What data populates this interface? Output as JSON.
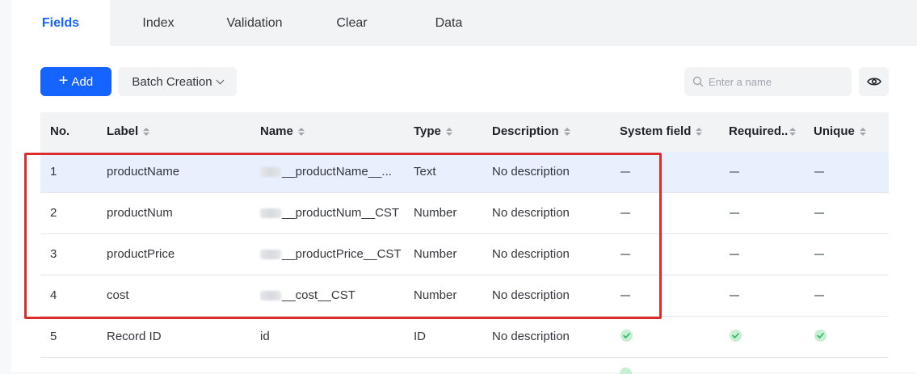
{
  "tabs": [
    {
      "label": "Fields",
      "active": true
    },
    {
      "label": "Index",
      "active": false
    },
    {
      "label": "Validation",
      "active": false
    },
    {
      "label": "Clear",
      "active": false
    },
    {
      "label": "Data",
      "active": false
    }
  ],
  "toolbar": {
    "add_label": "Add",
    "batch_label": "Batch Creation",
    "search_placeholder": "Enter a name"
  },
  "table": {
    "columns": [
      "No.",
      "Label",
      "Name",
      "Type",
      "Description",
      "System field",
      "Required..",
      "Unique"
    ],
    "rows": [
      {
        "no": "1",
        "label": "productName",
        "name": "__productName__...",
        "type": "Text",
        "description": "No description",
        "system": "dash",
        "required": "dash",
        "unique": "dash",
        "highlighted": true
      },
      {
        "no": "2",
        "label": "productNum",
        "name": "__productNum__CST",
        "type": "Number",
        "description": "No description",
        "system": "dash",
        "required": "dash",
        "unique": "dash",
        "highlighted": false
      },
      {
        "no": "3",
        "label": "productPrice",
        "name": "__productPrice__CST",
        "type": "Number",
        "description": "No description",
        "system": "dash",
        "required": "dash",
        "unique": "dash",
        "highlighted": false
      },
      {
        "no": "4",
        "label": "cost",
        "name": "__cost__CST",
        "type": "Number",
        "description": "No description",
        "system": "dash",
        "required": "dash",
        "unique": "dash",
        "highlighted": false
      },
      {
        "no": "5",
        "label": "Record ID",
        "name": "id",
        "type": "ID",
        "description": "No description",
        "system": "check",
        "required": "check",
        "unique": "check",
        "highlighted": false
      }
    ]
  },
  "colors": {
    "accent": "#1664ff",
    "highlight_row": "#e8f0fe",
    "annotation_red": "#e02b2b",
    "check_green": "#2bb85c"
  }
}
